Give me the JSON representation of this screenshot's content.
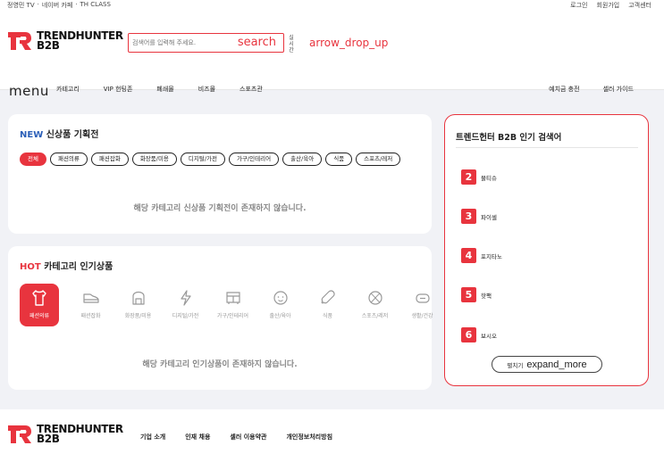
{
  "topbar": {
    "left_items": [
      "정영민 TV",
      "·",
      "네이버 카페",
      "·",
      "TH CLASS"
    ],
    "right_items": [
      "로그인",
      "회원가입",
      "고객센터"
    ]
  },
  "header": {
    "logo_line1": "TRENDHUNTER",
    "logo_line2": "B2B",
    "search_placeholder": "검색어를 입력해 주세요.",
    "search_button": "search",
    "live_rank_label": "실시간",
    "arrow_label": "arrow_drop_up"
  },
  "nav": {
    "menu_icon": "menu",
    "items": [
      "카테고리",
      "VIP 헌팅존",
      "폐쇄몰",
      "비즈몰",
      "스포츠관"
    ],
    "right_items": [
      "예치금 충전",
      "셀러 가이드"
    ]
  },
  "new_section": {
    "title_highlight": "NEW",
    "title_rest": "신상품 기획전",
    "chips": [
      "전체",
      "패션의류",
      "패션잡화",
      "화장품/미용",
      "디지털/가전",
      "가구/인테리어",
      "출산/육아",
      "식품",
      "스포츠/레저"
    ],
    "empty_message": "해당 카테고리 신상품 기획전이 존재하지 않습니다."
  },
  "hot_section": {
    "title_highlight": "HOT",
    "title_rest": "카테고리 인기상품",
    "categories": [
      {
        "label": "패션의류",
        "icon": "shirt-icon"
      },
      {
        "label": "패션잡화",
        "icon": "shoe-icon"
      },
      {
        "label": "화장품/미용",
        "icon": "cosmetics-icon"
      },
      {
        "label": "디지털/가전",
        "icon": "lightning-icon"
      },
      {
        "label": "가구/인테리어",
        "icon": "furniture-icon"
      },
      {
        "label": "출산/육아",
        "icon": "baby-icon"
      },
      {
        "label": "식품",
        "icon": "food-icon"
      },
      {
        "label": "스포츠/레저",
        "icon": "ball-icon"
      },
      {
        "label": "생활/건강",
        "icon": "health-icon"
      }
    ],
    "empty_message": "해당 카테고리 인기상품이 존재하지 않습니다."
  },
  "ranking": {
    "title": "트렌드헌터 B2B 인기 검색어",
    "items": [
      {
        "rank": "2",
        "keyword": "물티슈"
      },
      {
        "rank": "3",
        "keyword": "파이셀"
      },
      {
        "rank": "4",
        "keyword": "포지타노"
      },
      {
        "rank": "5",
        "keyword": "핫팩"
      },
      {
        "rank": "6",
        "keyword": "보시오"
      }
    ],
    "expand_label": "펼치기",
    "expand_icon_text": "expand_more"
  },
  "footer": {
    "logo_line1": "TRENDHUNTER",
    "logo_line2": "B2B",
    "links": [
      "기업 소개",
      "인재 채용",
      "셀러 이용약관",
      "개인정보처리방침"
    ]
  },
  "colors": {
    "accent": "#e8343e",
    "blue_highlight": "#2b5fb8",
    "background": "#f1f2f6"
  }
}
